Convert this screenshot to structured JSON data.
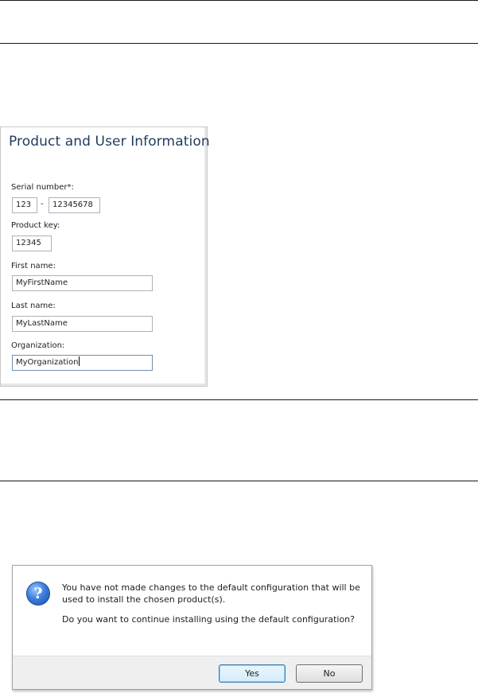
{
  "product_panel": {
    "title": "Product and User Information",
    "serial_label": "Serial number*:",
    "serial_part1": "123",
    "serial_separator": "-",
    "serial_part2": "12345678",
    "product_key_label": "Product key:",
    "product_key_value": "12345",
    "first_name_label": "First name:",
    "first_name_value": "MyFirstName",
    "last_name_label": "Last name:",
    "last_name_value": "MyLastName",
    "organization_label": "Organization:",
    "organization_value": "MyOrganization"
  },
  "dialog": {
    "icon": "question-icon",
    "message_line1": "You have not made changes to the default configuration that will be",
    "message_line2": "used to install the chosen product(s).",
    "question": "Do you want to continue installing using the default configuration?",
    "yes_label": "Yes",
    "no_label": "No"
  }
}
